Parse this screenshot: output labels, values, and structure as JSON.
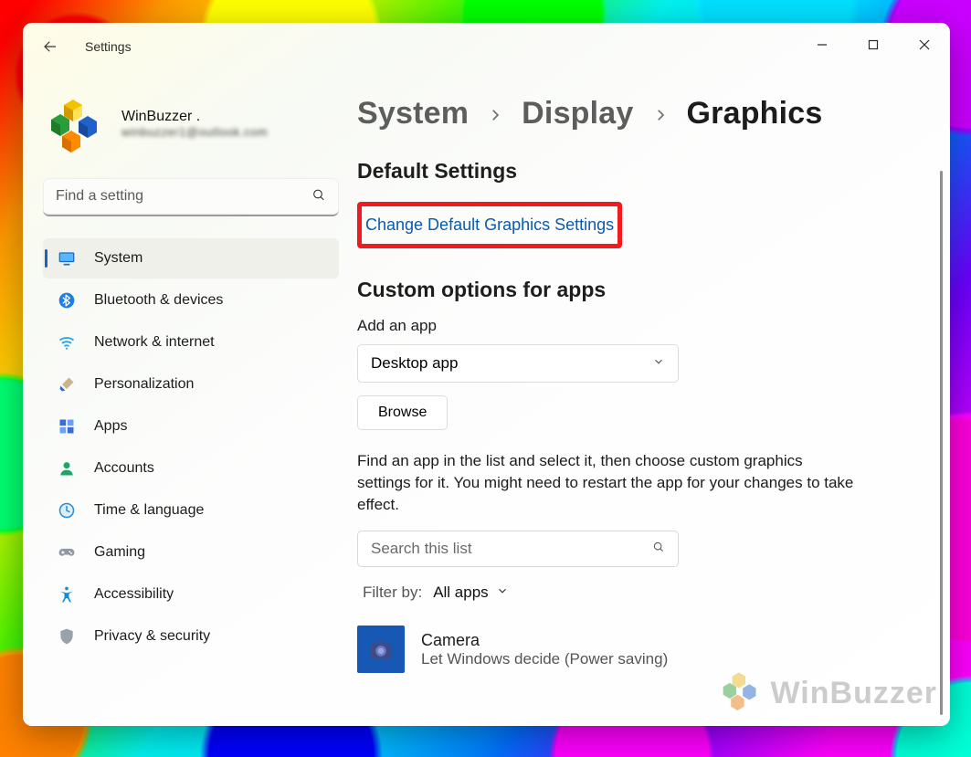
{
  "window": {
    "app_title": "Settings"
  },
  "account": {
    "display_name": "WinBuzzer .",
    "email_blurred": "winbuzzer1@outlook.com"
  },
  "search": {
    "placeholder": "Find a setting"
  },
  "sidebar": {
    "items": [
      {
        "label": "System"
      },
      {
        "label": "Bluetooth & devices"
      },
      {
        "label": "Network & internet"
      },
      {
        "label": "Personalization"
      },
      {
        "label": "Apps"
      },
      {
        "label": "Accounts"
      },
      {
        "label": "Time & language"
      },
      {
        "label": "Gaming"
      },
      {
        "label": "Accessibility"
      },
      {
        "label": "Privacy & security"
      }
    ],
    "active_index": 0
  },
  "breadcrumb": {
    "level1": "System",
    "level2": "Display",
    "level3": "Graphics"
  },
  "content": {
    "section_default": "Default Settings",
    "link_change_default": "Change Default Graphics Settings",
    "section_custom": "Custom options for apps",
    "add_app_label": "Add an app",
    "app_type_select": "Desktop app",
    "browse_button": "Browse",
    "help_text": "Find an app in the list and select it, then choose custom graphics settings for it. You might need to restart the app for your changes to take effect.",
    "list_search_placeholder": "Search this list",
    "filter_label": "Filter by:",
    "filter_value": "All apps",
    "app_list": [
      {
        "name": "Camera",
        "detail": "Let Windows decide (Power saving)"
      }
    ]
  },
  "watermark": "WinBuzzer"
}
